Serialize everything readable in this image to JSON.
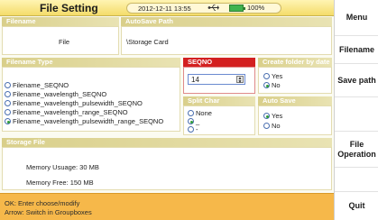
{
  "header": {
    "title": "File Setting",
    "datetime": "2012-12-11 13:55",
    "battery": "100%"
  },
  "filename": {
    "label": "Filename",
    "value": "File"
  },
  "autosave_path": {
    "label": "AutoSave Path",
    "value": "\\Storage Card"
  },
  "filename_type": {
    "label": "Filename Type",
    "options": [
      "Filename_SEQNO",
      "Filename_wavelength_SEQNO",
      "Filename_wavelength_pulsewidth_SEQNO",
      "Filename_wavelength_range_SEQNO",
      "Filename_wavelength_pulsewidth_range_SEQNO"
    ],
    "selected_index": 4
  },
  "seqno": {
    "label": "SEQNO",
    "value": "14"
  },
  "create_folder": {
    "label": "Create folder by date",
    "yes": "Yes",
    "no": "No",
    "selected": "No"
  },
  "split_char": {
    "label": "Split Char",
    "none": "None",
    "underscore": "_",
    "dash": "-",
    "selected": "_"
  },
  "auto_save": {
    "label": "Auto Save",
    "yes": "Yes",
    "no": "No",
    "selected": "Yes"
  },
  "storage": {
    "label": "Storage File",
    "usage": "Memory Usuage: 30 MB",
    "free": "Memory Free: 150 MB"
  },
  "hint": {
    "line1": "OK: Enter choose/modify",
    "line2": "Arrow: Switch in Groupboxes"
  },
  "sidebar": {
    "menu": "Menu",
    "filename": "Filename",
    "save_path": "Save path",
    "file_operation": "File Operation",
    "quit": "Quit"
  }
}
